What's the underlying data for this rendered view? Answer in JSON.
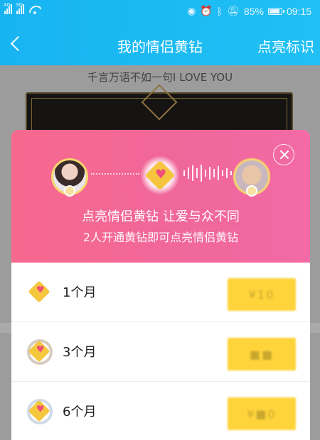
{
  "status_bar": {
    "sim_labels": [
      "4G",
      "3G"
    ],
    "battery": "85%",
    "battery_level": 0.85,
    "time": "09:15",
    "icons": [
      "eye-icon",
      "alarm-icon",
      "bluetooth-icon",
      "mute-icon",
      "wifi-icon"
    ]
  },
  "header": {
    "title": "我的情侣黄钻",
    "right_action": "点亮标识"
  },
  "background": {
    "caption": "千言万语不如一句I LOVE YOU"
  },
  "modal": {
    "headline": "点亮情侣黄钻 让爱与众不同",
    "subline": "2人开通黄钻即可点亮情侣黄钻",
    "options": [
      {
        "label": "1个月",
        "price": "¥10"
      },
      {
        "label": "3个月",
        "price": "■■"
      },
      {
        "label": "6个月",
        "price": "¥■0"
      }
    ]
  },
  "colors": {
    "header_blue": "#1cb8f3",
    "banner_pink": "#f26895",
    "price_yellow": "#ffd43b"
  }
}
